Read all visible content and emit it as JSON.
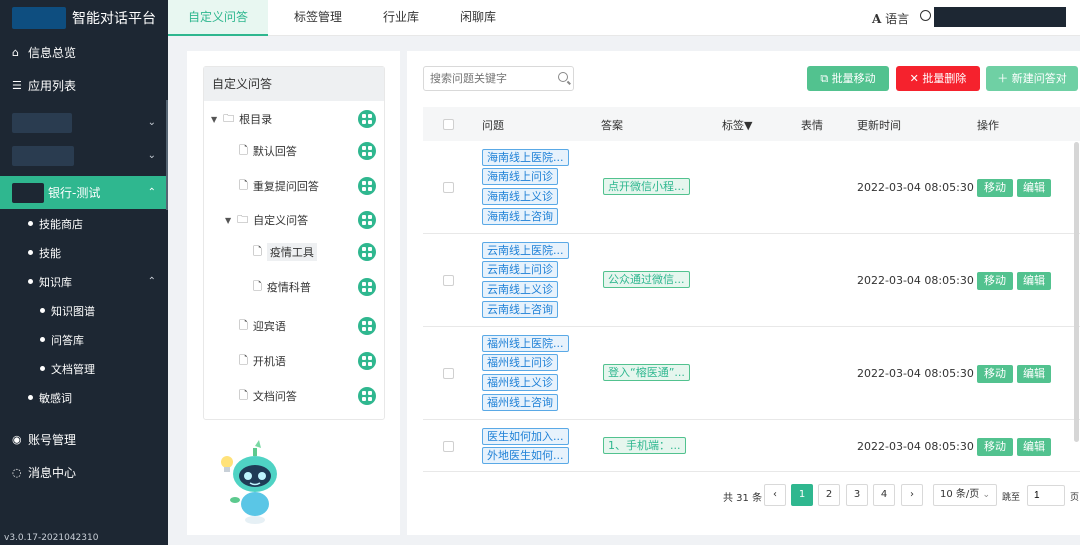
{
  "app": {
    "title": "智能对话平台",
    "version": "v3.0.17-2021042310"
  },
  "sidebar": {
    "top_items": [
      {
        "label": "信息总览",
        "icon": "home-icon"
      },
      {
        "label": "应用列表",
        "icon": "list-icon"
      }
    ],
    "active_item": {
      "label": "银行-测试"
    },
    "sub_items": [
      {
        "label": "技能商店"
      },
      {
        "label": "技能"
      },
      {
        "label": "知识库"
      }
    ],
    "kb_items": [
      {
        "label": "知识图谱"
      },
      {
        "label": "问答库"
      },
      {
        "label": "文档管理"
      }
    ],
    "more_items": [
      {
        "label": "敏感词"
      }
    ],
    "bottom_items": [
      {
        "label": "账号管理",
        "icon": "account-icon"
      },
      {
        "label": "消息中心",
        "icon": "message-icon"
      }
    ]
  },
  "topbar": {
    "tabs": [
      {
        "label": "自定义问答"
      },
      {
        "label": "标签管理"
      },
      {
        "label": "行业库"
      },
      {
        "label": "闲聊库"
      }
    ],
    "language": "语言"
  },
  "tree": {
    "header": "自定义问答",
    "nodes": [
      {
        "label": "根目录"
      },
      {
        "label": "默认回答"
      },
      {
        "label": "重复提问回答"
      },
      {
        "label": "自定义问答"
      },
      {
        "label": "疫情工具"
      },
      {
        "label": "疫情科普"
      },
      {
        "label": "迎宾语"
      },
      {
        "label": "开机语"
      },
      {
        "label": "文档问答"
      }
    ]
  },
  "toolbar": {
    "search_placeholder": "搜索问题关键字",
    "batch_move": "批量移动",
    "batch_delete": "批量删除",
    "new_qa": "新建问答对"
  },
  "table": {
    "columns": [
      "问题",
      "答案",
      "标签▼",
      "表情",
      "更新时间",
      "操作"
    ],
    "rows": [
      {
        "questions": [
          "海南线上医院...",
          "海南线上问诊",
          "海南线上义诊",
          "海南线上咨询"
        ],
        "answer": "点开微信小程...",
        "updated": "2022-03-04 08:05:30"
      },
      {
        "questions": [
          "云南线上医院...",
          "云南线上问诊",
          "云南线上义诊",
          "云南线上咨询"
        ],
        "answer": "公众通过微信...",
        "updated": "2022-03-04 08:05:30"
      },
      {
        "questions": [
          "福州线上医院...",
          "福州线上问诊",
          "福州线上义诊",
          "福州线上咨询"
        ],
        "answer": "登入“榕医通”...",
        "updated": "2022-03-04 08:05:30"
      },
      {
        "questions": [
          "医生如何加入...",
          "外地医生如何..."
        ],
        "answer": "1、手机端：...",
        "updated": "2022-03-04 08:05:30"
      }
    ],
    "move_label": "移动",
    "edit_label": "编辑"
  },
  "pagination": {
    "total": "共 31 条",
    "pages": [
      "1",
      "2",
      "3",
      "4"
    ],
    "current": "1",
    "page_size": "10 条/页",
    "jump_label": "跳至",
    "jump_value": "1",
    "page_suffix": "页"
  },
  "colors": {
    "accent": "#2fb78f",
    "danger": "#f5222d",
    "sidebar": "#1d2733",
    "tag_blue": "#1e80d6"
  }
}
